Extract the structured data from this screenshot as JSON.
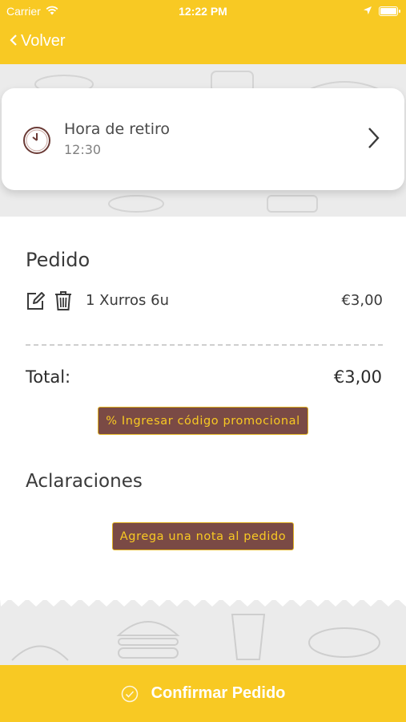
{
  "status_bar": {
    "carrier": "Carrier",
    "time": "12:22 PM",
    "icons": [
      "wifi-icon",
      "location-arrow-icon",
      "battery-icon"
    ]
  },
  "nav": {
    "back_label": "Volver"
  },
  "pickup": {
    "label": "Hora de retiro",
    "time": "12:30",
    "icon": "clock-icon"
  },
  "order": {
    "title": "Pedido",
    "items": [
      {
        "name": "1 Xurros 6u",
        "price": "€3,00"
      }
    ],
    "total_label": "Total:",
    "total_value": "€3,00",
    "promo_button": "% Ingresar código promocional"
  },
  "notes": {
    "title": "Aclaraciones",
    "add_note_button": "Agrega una nota al pedido"
  },
  "confirm": {
    "label": "Confirmar Pedido",
    "icon": "check-circle-icon"
  },
  "colors": {
    "brand_yellow": "#f8c923",
    "button_brown": "#7a4a45",
    "background": "#ebebeb"
  }
}
